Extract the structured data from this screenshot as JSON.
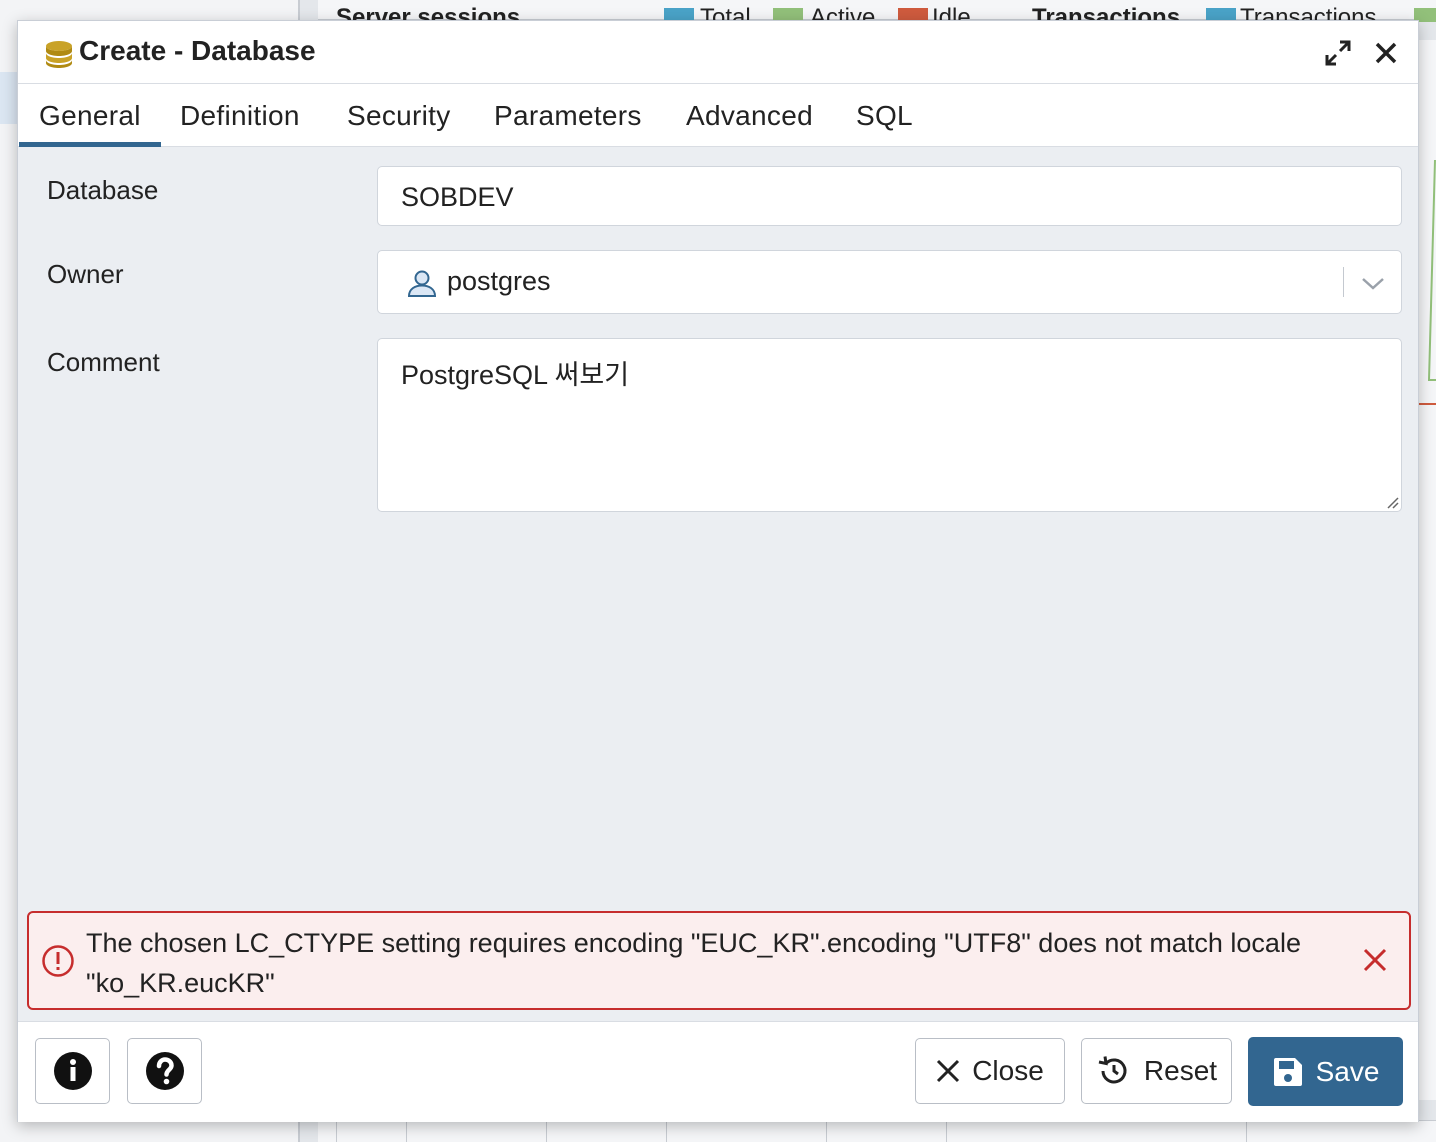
{
  "background": {
    "sessions_title": "Server sessions",
    "legend": [
      "Total",
      "Active",
      "Idle"
    ],
    "legend_colors": [
      "#4aa3c8",
      "#92c07a",
      "#cf5b3e"
    ],
    "transactions_title": "Transactions",
    "transactions_legend": "Transactions"
  },
  "dialog": {
    "title": "Create - Database",
    "title_icon": "database-icon",
    "maximize_icon": "expand-icon",
    "close_icon": "close-icon"
  },
  "tabs": [
    {
      "label": "General",
      "active": true
    },
    {
      "label": "Definition",
      "active": false
    },
    {
      "label": "Security",
      "active": false
    },
    {
      "label": "Parameters",
      "active": false
    },
    {
      "label": "Advanced",
      "active": false
    },
    {
      "label": "SQL",
      "active": false
    }
  ],
  "form": {
    "database_label": "Database",
    "database_value": "SOBDEV",
    "owner_label": "Owner",
    "owner_value": "postgres",
    "comment_label": "Comment",
    "comment_value": "PostgreSQL 써보기"
  },
  "error": {
    "message": "The chosen LC_CTYPE setting requires encoding \"EUC_KR\".encoding \"UTF8\" does not match locale \"ko_KR.eucKR\""
  },
  "footer": {
    "info_icon": "info-icon",
    "help_icon": "help-icon",
    "close_label": "Close",
    "reset_label": "Reset",
    "save_label": "Save"
  },
  "colors": {
    "accent": "#326690",
    "error_border": "#c62d2d",
    "error_bg": "#fbeeee"
  }
}
